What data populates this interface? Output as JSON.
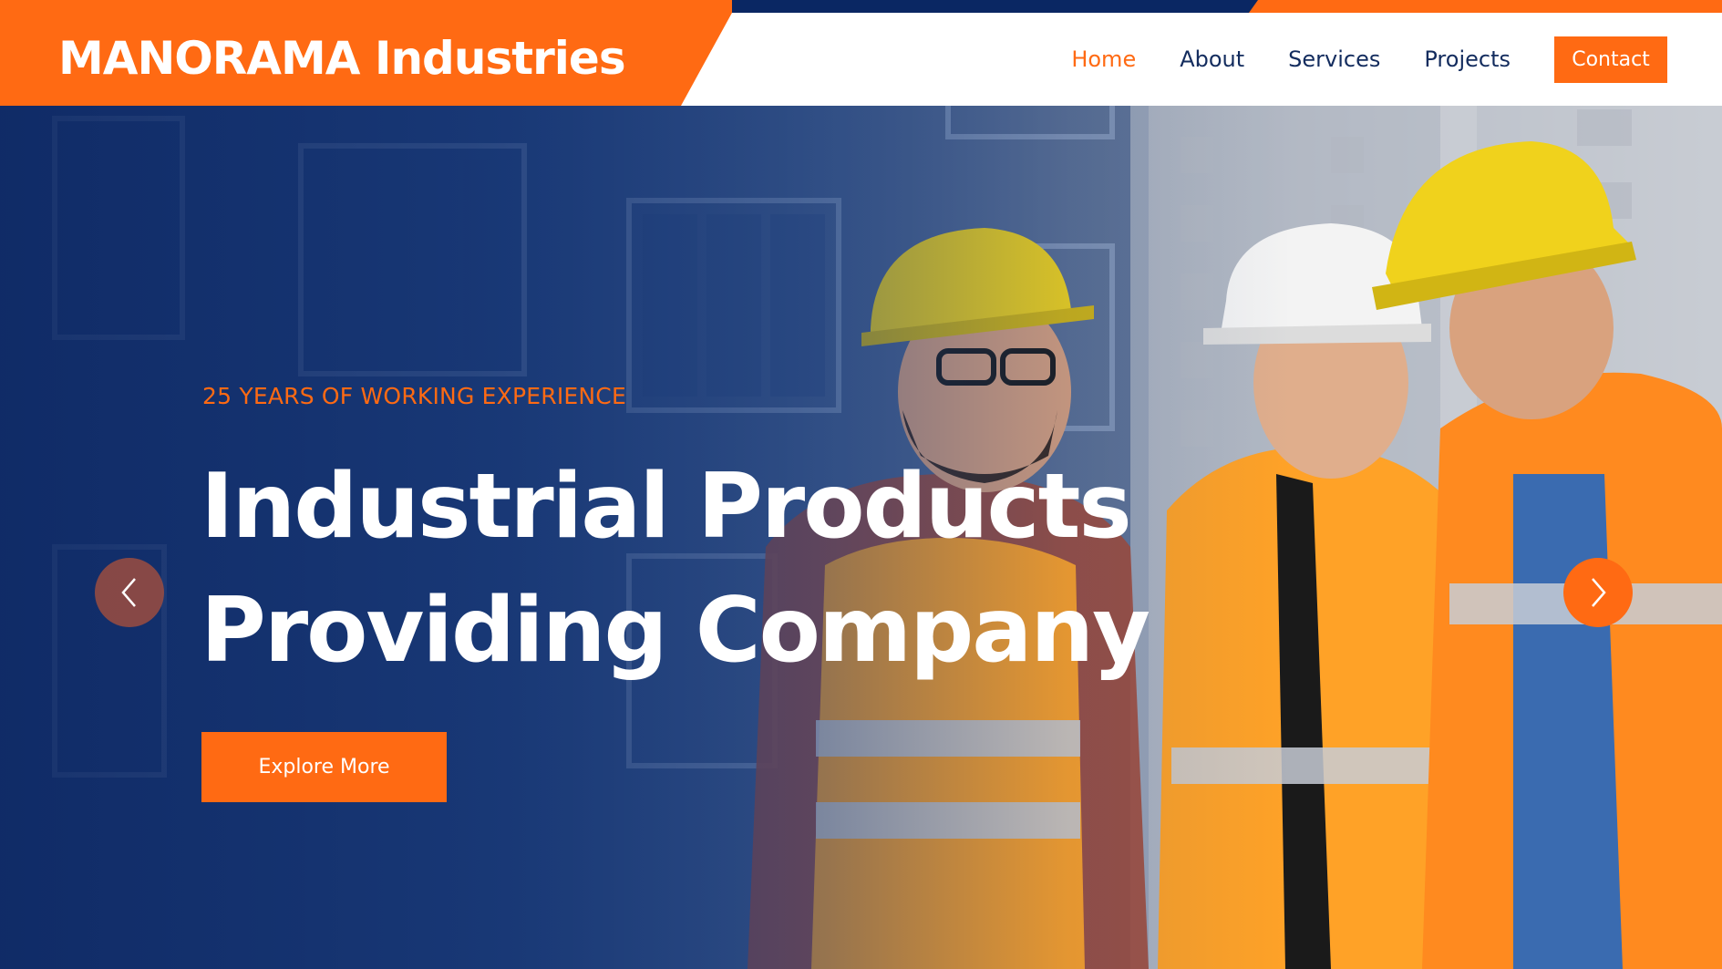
{
  "brand": {
    "name": "MANORAMA Industries"
  },
  "nav": {
    "items": [
      {
        "label": "Home",
        "active": true
      },
      {
        "label": "About",
        "active": false
      },
      {
        "label": "Services",
        "active": false
      },
      {
        "label": "Projects",
        "active": false
      }
    ],
    "cta_label": "Contact"
  },
  "hero": {
    "eyebrow": "25 YEARS OF WORKING EXPERIENCE",
    "title_line1": "Industrial Products",
    "title_line2": "Providing Company",
    "button_label": "Explore More",
    "prev_icon": "chevron-left-icon",
    "next_icon": "chevron-right-icon"
  },
  "colors": {
    "accent": "#ff6a13",
    "navy": "#0a2763",
    "nav_text": "#132c5e",
    "header_bg": "#ffffff",
    "title_text": "#ffffff"
  }
}
